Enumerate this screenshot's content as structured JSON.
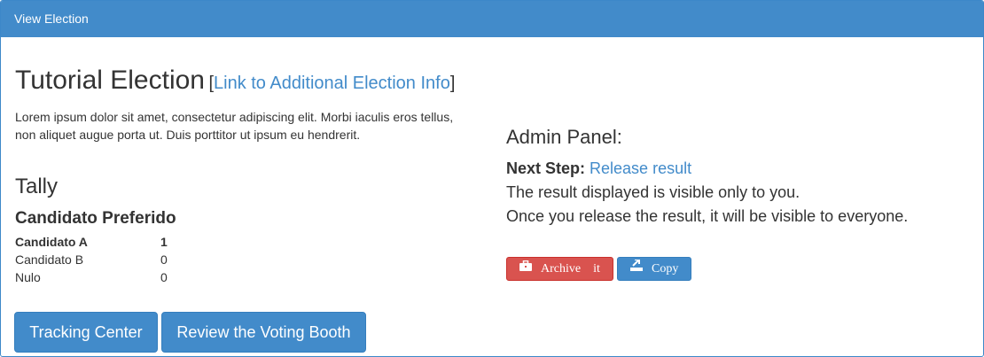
{
  "panel": {
    "heading": "View Election"
  },
  "election": {
    "title": "Tutorial Election",
    "bracket_open": "[",
    "bracket_close": "]",
    "info_link": "Link to Additional Election Info",
    "description": "Lorem ipsum dolor sit amet, consectetur adipiscing elit. Morbi iaculis eros tellus, non aliquet augue porta ut. Duis porttitor ut ipsum eu hendrerit."
  },
  "tally": {
    "heading": "Tally",
    "question": "Candidato Preferido",
    "rows": [
      {
        "name": "Candidato A",
        "count": "1"
      },
      {
        "name": "Candidato B",
        "count": "0"
      },
      {
        "name": "Nulo",
        "count": "0"
      }
    ]
  },
  "buttons": {
    "tracking": "Tracking Center",
    "review": "Review the Voting Booth"
  },
  "admin": {
    "heading": "Admin Panel:",
    "next_step_label": "Next Step:",
    "next_step_link": "Release result",
    "line1": "The result displayed is visible only to you.",
    "line2": "Once you release the result, it will be visible to everyone.",
    "archive_word1": "Archive",
    "archive_word2": "it",
    "copy": "Copy"
  },
  "icons": {
    "archive": "briefcase-icon",
    "copy": "export-icon"
  },
  "colors": {
    "primary": "#428bca",
    "danger": "#d9534f",
    "text": "#333333"
  }
}
